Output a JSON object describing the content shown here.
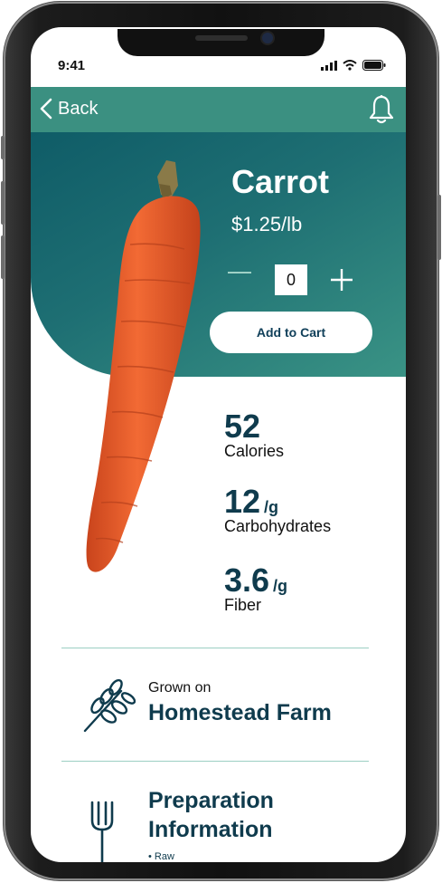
{
  "status": {
    "time": "9:41"
  },
  "nav": {
    "back_label": "Back"
  },
  "product": {
    "name": "Carrot",
    "price": "$1.25/lb",
    "quantity": "0",
    "add_to_cart_label": "Add to Cart"
  },
  "nutrition": [
    {
      "value": "52",
      "unit": "",
      "label": "Calories"
    },
    {
      "value": "12",
      "unit": "/g",
      "label": "Carbohydrates"
    },
    {
      "value": "3.6",
      "unit": "/g",
      "label": "Fiber"
    }
  ],
  "farm": {
    "kicker": "Grown on",
    "name": "Homestead Farm"
  },
  "preparation": {
    "title": "Preparation Information",
    "items": [
      "Raw"
    ]
  },
  "colors": {
    "accent": "#3b9081",
    "dark_teal": "#0f5c67",
    "text_dark": "#0f3b4d"
  },
  "icons": [
    "back-chevron-icon",
    "bell-icon",
    "wheat-icon",
    "fork-icon",
    "signal-icon",
    "wifi-icon",
    "battery-icon"
  ]
}
